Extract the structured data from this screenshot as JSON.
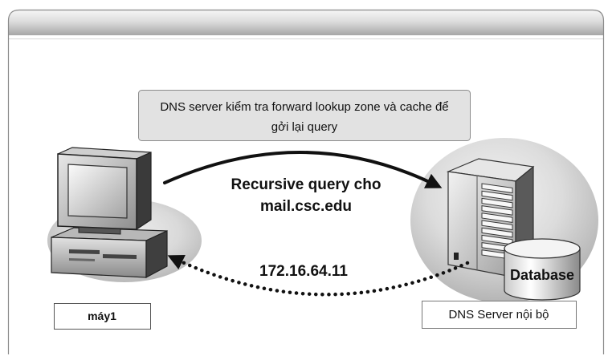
{
  "diagram": {
    "callout": {
      "line1": "DNS server kiểm tra forward lookup zone và cache để",
      "line2": "gởi lại query"
    },
    "request": {
      "line1": "Recursive query cho",
      "line2": "mail.csc.edu"
    },
    "response": {
      "address": "172.16.64.11"
    },
    "client": {
      "label": "máy1",
      "icon": "desktop-computer-icon"
    },
    "server": {
      "label": "DNS Server nội bộ",
      "icon": "server-tower-icon"
    },
    "database": {
      "label": "Database",
      "icon": "database-cylinder-icon"
    }
  },
  "colors": {
    "arrow": "#111111",
    "callout_fill": "#e2e2e2",
    "frame_border": "#8a8a8a"
  }
}
